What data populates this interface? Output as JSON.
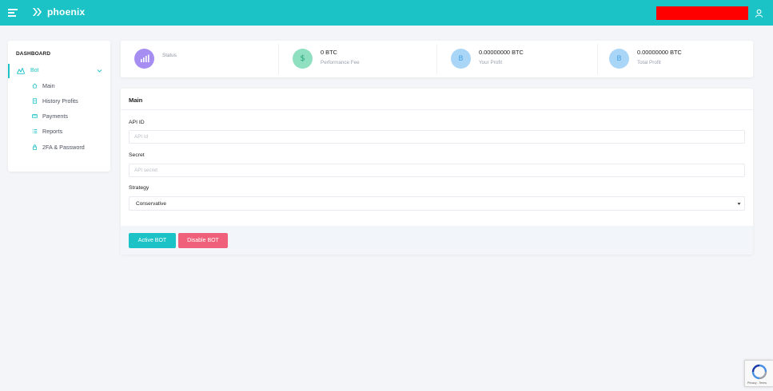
{
  "header": {
    "logo_text": "phoenix",
    "accent_color": "#1cc3c6"
  },
  "sidebar": {
    "heading": "DASHBOARD",
    "group": {
      "label": "Bot",
      "icon": "chart-area-icon",
      "expanded": true
    },
    "items": [
      {
        "label": "Main",
        "icon": "home-icon"
      },
      {
        "label": "History Profits",
        "icon": "document-icon"
      },
      {
        "label": "Payments",
        "icon": "credit-card-icon"
      },
      {
        "label": "Reports",
        "icon": "list-icon"
      },
      {
        "label": "2FA & Password",
        "icon": "lock-icon"
      }
    ]
  },
  "stats": [
    {
      "value": "",
      "label": "Status",
      "icon": "bar-chart-icon",
      "color": "#a58df2"
    },
    {
      "value": "0 BTC",
      "label": "Performance Fee",
      "icon": "dollar-icon",
      "color": "#7ddcb8"
    },
    {
      "value": "0.00000000 BTC",
      "label": "Your Profit",
      "icon": "bitcoin-icon",
      "color": "#8fc9f5"
    },
    {
      "value": "0.00000000 BTC",
      "label": "Total Profit",
      "icon": "bitcoin-icon",
      "color": "#8fc9f5"
    }
  ],
  "main": {
    "title": "Main",
    "api_id": {
      "label": "API ID",
      "placeholder": "API Id",
      "value": ""
    },
    "secret": {
      "label": "Secret",
      "placeholder": "API secret",
      "value": ""
    },
    "strategy": {
      "label": "Strategy",
      "selected": "Conservative"
    },
    "buttons": {
      "active": {
        "label": "Active BOT",
        "color": "#1cc3c6"
      },
      "disable": {
        "label": "Disable BOT",
        "color": "#f1607a"
      }
    }
  },
  "recaptcha": {
    "text": "Privacy - Terms"
  }
}
